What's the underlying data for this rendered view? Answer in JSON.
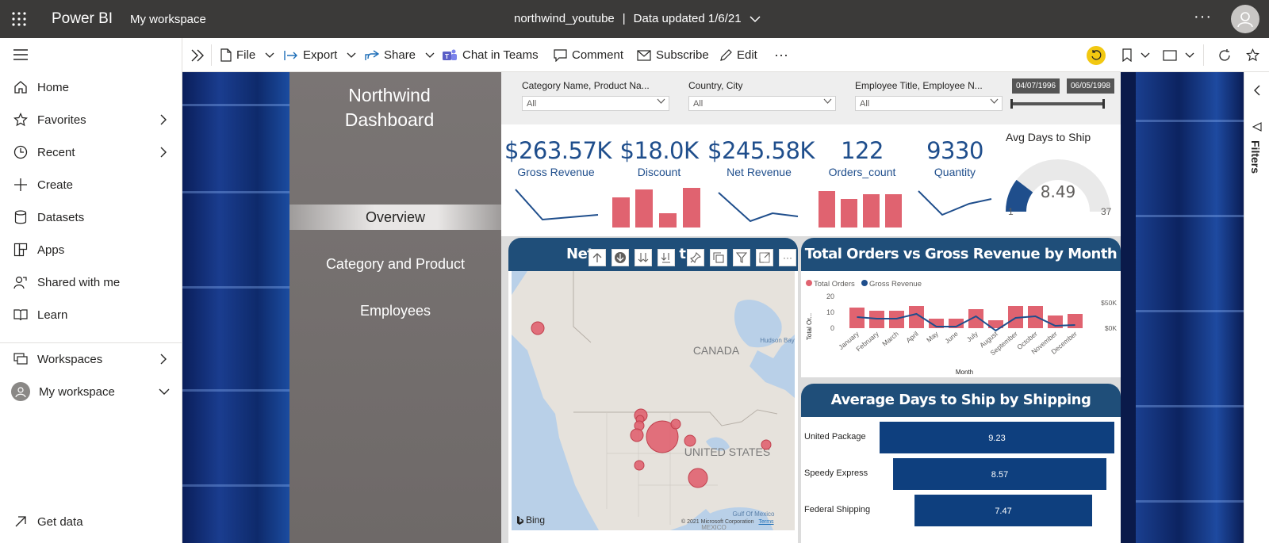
{
  "topbar": {
    "app": "Power BI",
    "workspace": "My workspace",
    "report": "northwind_youtube",
    "separator": "|",
    "updated": "Data updated 1/6/21",
    "more": "···"
  },
  "leftnav": {
    "items": [
      {
        "label": "Home",
        "icon": "home-icon"
      },
      {
        "label": "Favorites",
        "icon": "star-icon",
        "chev": "›"
      },
      {
        "label": "Recent",
        "icon": "clock-icon",
        "chev": "›"
      },
      {
        "label": "Create",
        "icon": "plus-icon"
      },
      {
        "label": "Datasets",
        "icon": "database-icon"
      },
      {
        "label": "Apps",
        "icon": "apps-icon"
      },
      {
        "label": "Shared with me",
        "icon": "shared-icon"
      },
      {
        "label": "Learn",
        "icon": "book-icon"
      }
    ],
    "workspaces": "Workspaces",
    "my_workspace": "My workspace",
    "get_data": "Get data"
  },
  "toolbar": {
    "file": "File",
    "export": "Export",
    "share": "Share",
    "chat": "Chat in Teams",
    "comment": "Comment",
    "subscribe": "Subscribe",
    "edit": "Edit",
    "more": "···"
  },
  "report": {
    "title_line1": "Northwind",
    "title_line2": "Dashboard",
    "nav": [
      "Overview",
      "Category and Product",
      "Employees"
    ],
    "slicers": [
      {
        "label": "Category Name, Product Na...",
        "value": "All"
      },
      {
        "label": "Country, City",
        "value": "All"
      },
      {
        "label": "Employee Title, Employee N...",
        "value": "All"
      }
    ],
    "date_from": "04/07/1996",
    "date_to": "06/05/1998",
    "kpis": [
      {
        "value": "$263.57K",
        "label": "Gross Revenue"
      },
      {
        "value": "$18.0K",
        "label": "Discount"
      },
      {
        "value": "$245.58K",
        "label": "Net Revenue"
      },
      {
        "value": "122",
        "label": "Orders_count"
      },
      {
        "value": "9330",
        "label": "Quantity"
      }
    ],
    "gauge": {
      "title": "Avg Days to Ship",
      "value": "8.49",
      "min": "1",
      "max": "37",
      "value_num": 8.49,
      "min_num": 1,
      "max_num": 37
    },
    "map": {
      "title": "Net",
      "title_tail": "tr",
      "canada": "CANADA",
      "usa": "UNITED STATES",
      "hudson": "Hudson Bay",
      "gulf": "Gulf Of Mexico",
      "mexico": "MEXICO",
      "bing": "Bing",
      "copyright": "© 2021 Microsoft Corporation",
      "terms": "Terms"
    },
    "colors": {
      "accent": "#1f4e79",
      "bar_red": "#e06370",
      "kpi_blue": "#1f4e8c"
    }
  },
  "filters_label": "Filters",
  "chart_data": [
    {
      "type": "bar",
      "title": "Total Orders vs Gross Revenue by Month",
      "xlabel": "Month",
      "ylabel": "Total Or...",
      "y2label": "",
      "legend": [
        "Total Orders",
        "Gross Revenue"
      ],
      "categories": [
        "January",
        "February",
        "March",
        "April",
        "May",
        "June",
        "July",
        "August",
        "September",
        "October",
        "November",
        "December"
      ],
      "y_ticks": [
        "0",
        "10",
        "20"
      ],
      "y2_ticks": [
        "$0K",
        "$50K"
      ],
      "series": [
        {
          "name": "Total Orders",
          "type": "bar",
          "values": [
            13,
            11,
            11,
            14,
            6,
            6,
            12,
            5,
            14,
            14,
            8,
            9
          ]
        },
        {
          "name": "Gross Revenue",
          "type": "line",
          "values": [
            24,
            22,
            22,
            28,
            12,
            12,
            25,
            7,
            23,
            25,
            13,
            14
          ]
        }
      ],
      "ylim": [
        0,
        20
      ]
    },
    {
      "type": "bar",
      "orientation": "horizontal",
      "title": "Average Days to Ship by Shipping Company",
      "categories": [
        "United Package",
        "Speedy Express",
        "Federal Shipping"
      ],
      "values": [
        9.23,
        8.57,
        7.47
      ],
      "labels": [
        "9.23",
        "8.57",
        "7.47"
      ]
    }
  ]
}
